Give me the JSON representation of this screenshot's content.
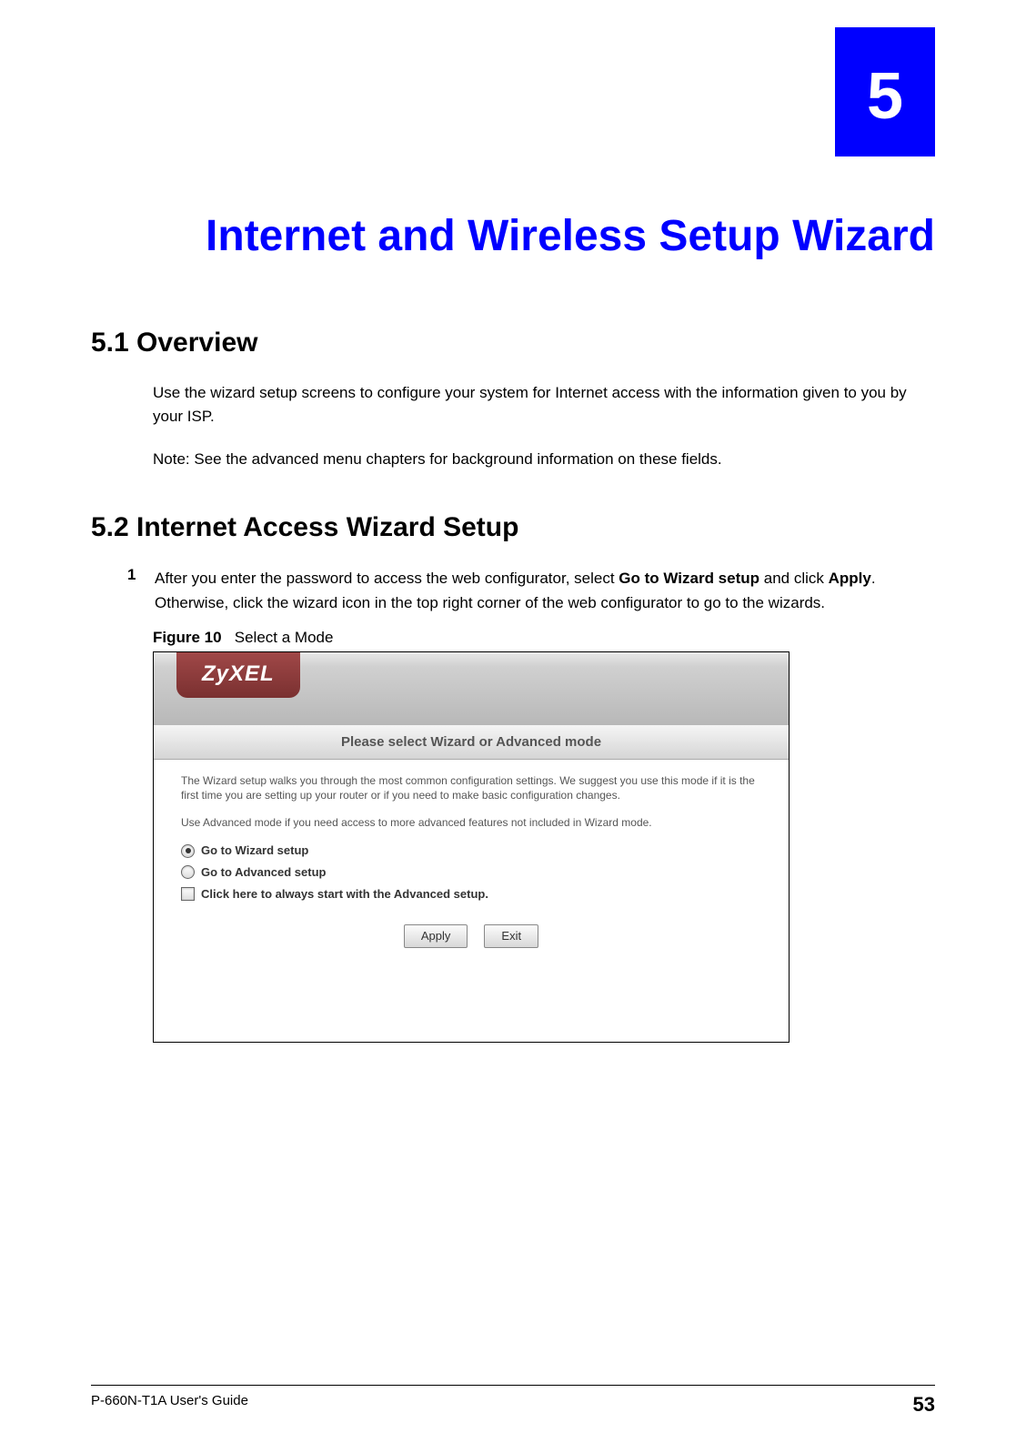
{
  "chapter": {
    "number": "5",
    "title": "Internet and Wireless Setup Wizard"
  },
  "sections": {
    "s1": {
      "heading": "5.1  Overview",
      "body": "Use the wizard setup screens to configure your system for Internet access with the information given to you by your ISP.",
      "note": "Note: See the advanced menu chapters for background information on these fields."
    },
    "s2": {
      "heading": "5.2  Internet Access Wizard Setup",
      "step1_num": "1",
      "step1_p1": "After you enter the password to access the web configurator, select ",
      "step1_b1": "Go to Wizard setup",
      "step1_p2": " and click ",
      "step1_b2": "Apply",
      "step1_p3": ". Otherwise, click the wizard icon in the top right corner of the web configurator to go to the wizards."
    }
  },
  "figure": {
    "label": "Figure 10",
    "caption": "Select a Mode",
    "logo": "ZyXEL",
    "dialog_title": "Please select Wizard or Advanced mode",
    "para1": "The Wizard setup walks you through the most common configuration settings. We suggest you use this mode if it is the first time you are setting up your router or if you need to make basic configuration changes.",
    "para2": "Use Advanced mode if you need access to more advanced features not included in Wizard mode.",
    "opt_wizard": "Go to Wizard setup",
    "opt_advanced": "Go to Advanced setup",
    "opt_checkbox": "Click here to always start with the Advanced setup.",
    "btn_apply": "Apply",
    "btn_exit": "Exit"
  },
  "footer": {
    "guide": "P-660N-T1A User's Guide",
    "page": "53"
  }
}
